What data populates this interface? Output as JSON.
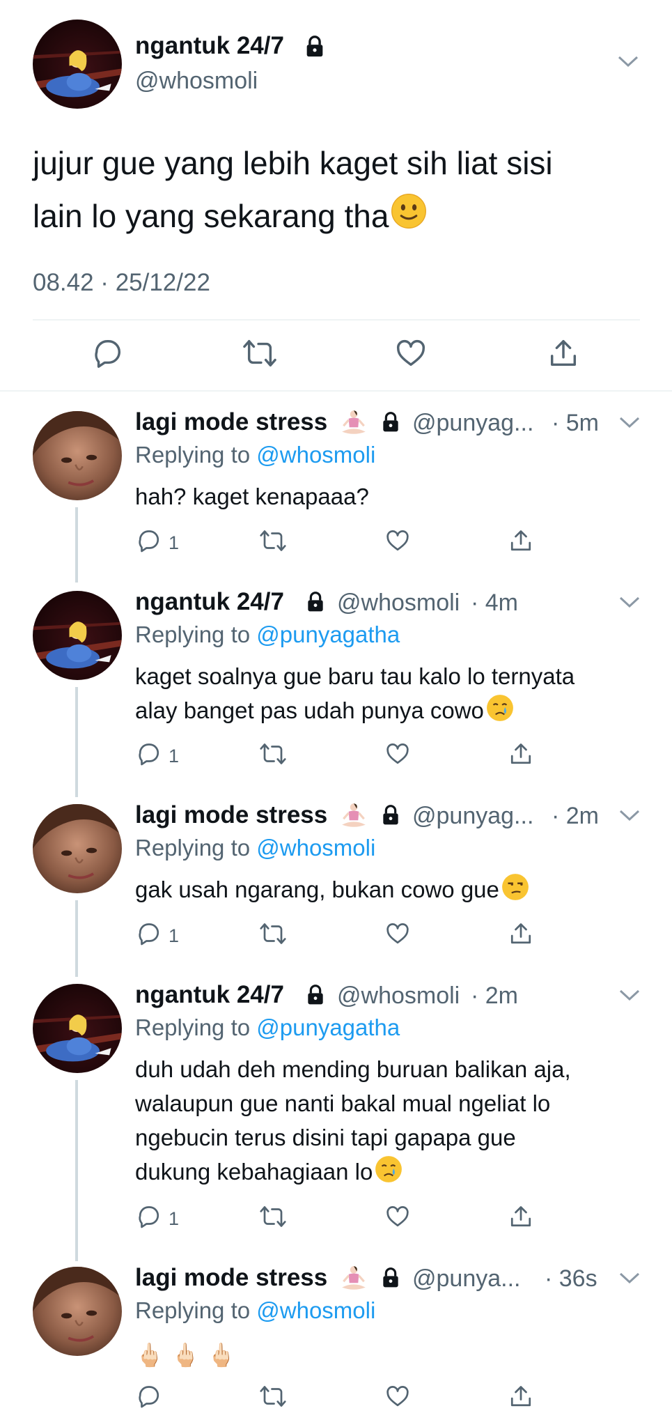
{
  "main_tweet": {
    "name": "ngantuk 24/7",
    "handle": "@whosmoli",
    "text_line1": "jujur gue yang lebih kaget sih liat sisi",
    "text_line2": "lain lo yang sekarang tha",
    "timestamp": "08.42 · 25/12/22"
  },
  "replies": [
    {
      "name": "lagi mode stress",
      "handle": "@punyag...",
      "time": "· 5m",
      "replying_prefix": "Replying to ",
      "replying_to": "@whosmoli",
      "lines": [
        "hah? kaget kenapaaa?"
      ],
      "reply_count": "1"
    },
    {
      "name": "ngantuk 24/7",
      "handle": "@whosmoli",
      "time": "· 4m",
      "replying_prefix": "Replying to ",
      "replying_to": "@punyagatha",
      "lines": [
        "kaget soalnya gue baru tau kalo lo ternyata",
        "alay banget pas udah punya cowo"
      ],
      "reply_count": "1"
    },
    {
      "name": "lagi mode stress",
      "handle": "@punyag...",
      "time": "· 2m",
      "replying_prefix": "Replying to ",
      "replying_to": "@whosmoli",
      "lines": [
        "gak usah ngarang, bukan cowo gue"
      ],
      "reply_count": "1"
    },
    {
      "name": "ngantuk 24/7",
      "handle": "@whosmoli",
      "time": "· 2m",
      "replying_prefix": "Replying to ",
      "replying_to": "@punyagatha",
      "lines": [
        "duh udah deh mending buruan balikan aja,",
        "walaupun gue nanti bakal mual ngeliat lo",
        "ngebucin terus disini tapi gapapa gue",
        "dukung kebahagiaan lo"
      ],
      "reply_count": "1"
    },
    {
      "name": "lagi mode stress",
      "handle": "@punya...",
      "time": "· 36s",
      "replying_prefix": "Replying to ",
      "replying_to": "@whosmoli",
      "lines": [
        "🖕🏻 🖕🏻 🖕🏻"
      ],
      "reply_count": ""
    }
  ],
  "icons": {
    "lock": "lock-icon",
    "chevron": "chevron-down-icon",
    "reply": "reply-icon",
    "retweet": "retweet-icon",
    "like": "heart-icon",
    "share": "share-icon",
    "slight_smile": "slightly-smiling-face-emoji",
    "crying": "crying-face-emoji",
    "unamused": "unamused-face-emoji",
    "lotus": "lotus-position-emoji"
  },
  "colors": {
    "link": "#1d9bf0",
    "secondary": "#536471",
    "divider": "#eff3f4",
    "thread_line": "#cfd9de"
  }
}
